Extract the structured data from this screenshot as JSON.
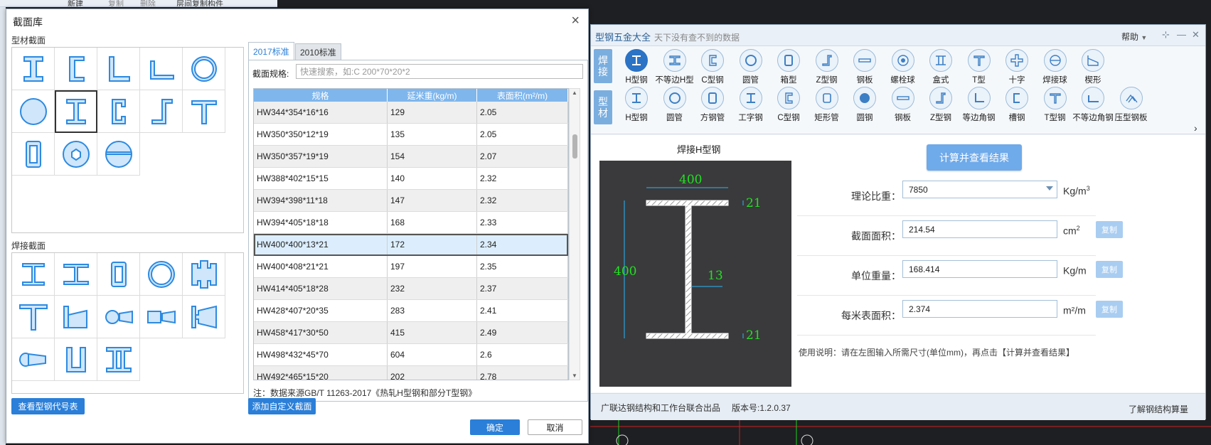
{
  "background": {
    "toolbar_text": [
      "新建",
      "复制",
      "删除",
      "层间复制构件"
    ]
  },
  "dialog": {
    "title": "截面库",
    "section_profile_label": "型材截面",
    "section_weld_label": "焊接截面",
    "profile_shapes": [
      "i-beam-icon",
      "channel-icon",
      "angle-icon",
      "unequal-angle-icon",
      "round-tube-icon",
      "round-bar-icon",
      "h-beam-icon",
      "c-section-icon",
      "z-section-icon",
      "t-section-icon",
      "rect-tube-icon",
      "hex-bar-icon",
      "sphere-icon"
    ],
    "weld_shapes": [
      "weld-i-icon",
      "weld-h-icon",
      "weld-box-icon",
      "weld-pipe-icon",
      "weld-cross-icon",
      "weld-t-icon",
      "weld-tapered-icon",
      "weld-pipe-taper-icon",
      "weld-box-taper-icon",
      "weld-i-taper-icon",
      "weld-cone-icon",
      "weld-u-icon",
      "weld-double-i-icon"
    ],
    "view_code_button": "查看型钢代号表",
    "tabs": [
      {
        "label": "2017标准"
      },
      {
        "label": "2010标准"
      }
    ],
    "search_label": "截面规格:",
    "search_placeholder": "快速搜索，如:C 200*70*20*2",
    "table": {
      "headers": [
        "规格",
        "延米重(kg/m)",
        "表面积(m²/m)"
      ],
      "rows": [
        [
          "HW344*354*16*16",
          "129",
          "2.05"
        ],
        [
          "HW350*350*12*19",
          "135",
          "2.05"
        ],
        [
          "HW350*357*19*19",
          "154",
          "2.07"
        ],
        [
          "HW388*402*15*15",
          "140",
          "2.32"
        ],
        [
          "HW394*398*11*18",
          "147",
          "2.32"
        ],
        [
          "HW394*405*18*18",
          "168",
          "2.33"
        ],
        [
          "HW400*400*13*21",
          "172",
          "2.34"
        ],
        [
          "HW400*408*21*21",
          "197",
          "2.35"
        ],
        [
          "HW414*405*18*28",
          "232",
          "2.37"
        ],
        [
          "HW428*407*20*35",
          "283",
          "2.41"
        ],
        [
          "HW458*417*30*50",
          "415",
          "2.49"
        ],
        [
          "HW498*432*45*70",
          "604",
          "2.6"
        ],
        [
          "HW492*465*15*20",
          "202",
          "2.78"
        ]
      ],
      "selected_index": 6
    },
    "note": "注：数据来源GB/T 11263-2017《热轧H型钢和部分T型钢》",
    "add_custom_button": "添加自定义截面",
    "ok_button": "确定",
    "cancel_button": "取消"
  },
  "app": {
    "title": "型钢五金大全",
    "slogan": "天下没有查不到的数据",
    "help_label": "帮助",
    "side_tab_weld": "焊\n接",
    "side_tab_profile": "型\n材",
    "weld_items": [
      "H型钢",
      "不等边H型",
      "C型钢",
      "圆管",
      "箱型",
      "Z型钢",
      "钢板",
      "螺栓球",
      "盒式",
      "T型",
      "十字",
      "焊接球",
      "楔形"
    ],
    "profile_items": [
      "H型钢",
      "圆管",
      "方钢管",
      "工字钢",
      "C型钢",
      "矩形管",
      "圆钢",
      "钢板",
      "Z型钢",
      "等边角钢",
      "槽钢",
      "T型钢",
      "不等边角钢",
      "压型钢板"
    ],
    "drawing_title": "焊接H型钢",
    "drawing": {
      "width_top": "400",
      "height": "400",
      "flange_top": "21",
      "flange_bottom": "21",
      "web": "13"
    },
    "calc_button": "计算并查看结果",
    "fields": [
      {
        "label": "理论比重：",
        "value": "7850",
        "unit": "Kg/m",
        "unit_sup": "3",
        "copy": ""
      },
      {
        "label": "截面面积：",
        "value": "214.54",
        "unit": "cm",
        "unit_sup": "2",
        "copy": "复制"
      },
      {
        "label": "单位重量：",
        "value": "168.414",
        "unit": "Kg/m",
        "unit_sup": "",
        "copy": "复制"
      },
      {
        "label": "每米表面积：",
        "value": "2.374",
        "unit": "m²/m",
        "unit_sup": "",
        "copy": "复制"
      }
    ],
    "usage": "使用说明：请在左图输入所需尺寸(单位mm)，再点击【计算并查看结果】",
    "status_left": "广联达钢结构和工作台联合出品",
    "status_version": "版本号:1.2.0.37",
    "status_right": "了解钢结构算量",
    "colors": {
      "accent": "#2b7fd8",
      "drawing_dim": "#22e022",
      "drawing_bg": "#3a3a3c"
    }
  }
}
